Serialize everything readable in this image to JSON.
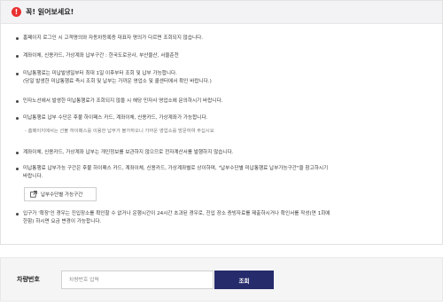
{
  "notice": {
    "title": "꼭! 읽어보세요!",
    "alert_icon_glyph": "!",
    "items": [
      {
        "lines": [
          "홈페이지 로그인 시 고객명의와 자동차등록증 대표자 명의가 다르면 조회되지 않습니다."
        ]
      },
      {
        "lines": [
          "계좌이체, 신용카드, 가상계좌 납부구간 : 한국도로공사, 부산울산, 서울춘천"
        ]
      },
      {
        "lines": [
          "미납통행료는 미납발생일부터 최대 1일 이후부터 조회 및 납부 가능합니다.",
          "(당일 발생한 미납통행료 즉시 조회 및 납부는 가까운 영업소 및 콜센터에서 확인 바랍니다.)"
        ]
      },
      {
        "lines": [
          "민자노선에서 발생한 미납통행료가 조회되지 않을 시 해당 민자사 영업소에 문의하시기 바랍니다."
        ]
      },
      {
        "lines": [
          "미납통행료 납부 수단은 후불 하이패스 카드, 계좌이체, 신용카드, 가상계좌가 가능합니다."
        ],
        "sub_note": "- 홈페이지에서는 선불 하이패스를 이용한 납부가 불가하오니 가까운 영업소를 방문하여 주십시요"
      },
      {
        "lines": [
          "계좌이체, 신용카드, 가상계좌 납부는 개인정보를 보관하지 않으므로 전자계산서를 발행하지 않습니다."
        ]
      },
      {
        "lines": [
          "미납통행료 납부가능 구간은 후불 하이패스 카드, 계좌이체, 신용카드, 가상계좌별로 상이하며, \"납부수단별 미납통행료 납부가능구간\"을 참고하시기",
          "바랍니다."
        ]
      },
      {
        "lines": [
          "입구가 '확장'인 경우는 진입장소를 확인할 수 없거나 운행시간이 24시간 초과된 경우로, 진입 장소 증빙자료를 제출하시거나 확인서를 작성(연 1회에",
          "한함) 하시면 요금 변경이 가능합니다."
        ]
      }
    ],
    "link_button_label": "납부수단별 가능구간"
  },
  "search": {
    "label": "차량번호",
    "placeholder": "차량번호 입력",
    "value": "",
    "button_label": "조회"
  },
  "colors": {
    "alert": "#e9302f",
    "button": "#262b6b",
    "header_bg": "#f3f3f5",
    "search_bg": "#f5f5f5"
  }
}
